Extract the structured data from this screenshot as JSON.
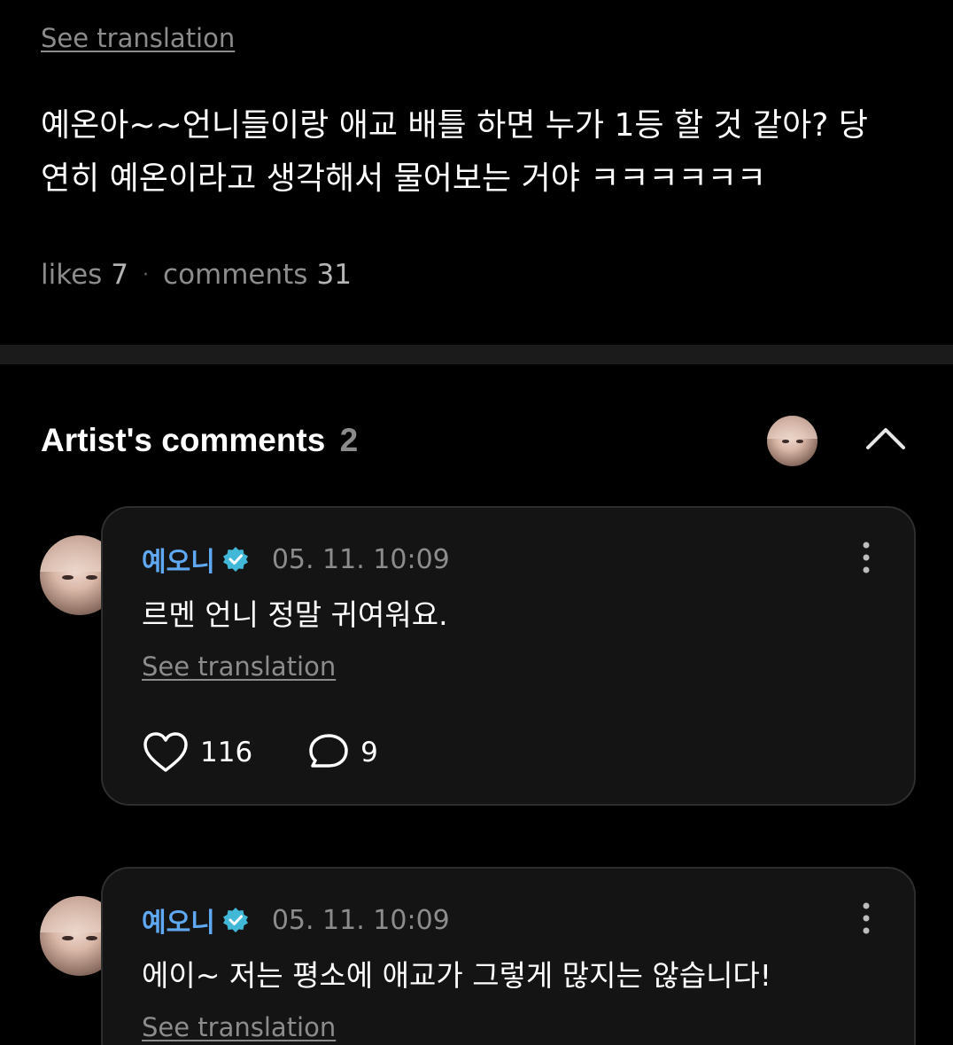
{
  "post": {
    "see_translation": "See translation",
    "body_line1": "예온아~~언니들이랑 애교 배틀 하면 누가 1등 할 것 같아? 당",
    "body_line2": "연히 예온이라고 생각해서 물어보는 거야 ㅋㅋㅋㅋㅋㅋ",
    "likes_label": "likes",
    "likes_count": "7",
    "separator": "·",
    "comments_label": "comments",
    "comments_count": "31"
  },
  "artist_comments": {
    "title": "Artist's comments",
    "count": "2",
    "collapse_icon": "chevron-up-icon",
    "items": [
      {
        "author": "예오니",
        "timestamp": "05. 11. 10:09",
        "text": "르멘 언니 정말 귀여워요.",
        "see_translation": "See translation",
        "like_count": "116",
        "reply_count": "9"
      },
      {
        "author": "예오니",
        "timestamp": "05. 11. 10:09",
        "text": "에이~ 저는 평소에 애교가 그렇게 많지는 않습니다!",
        "see_translation": "See translation"
      }
    ]
  },
  "colors": {
    "background": "#000000",
    "card": "#141414",
    "author": "#5fa8f2",
    "verified_badge": "#42b8d8",
    "muted_text": "#8c8c8c"
  }
}
